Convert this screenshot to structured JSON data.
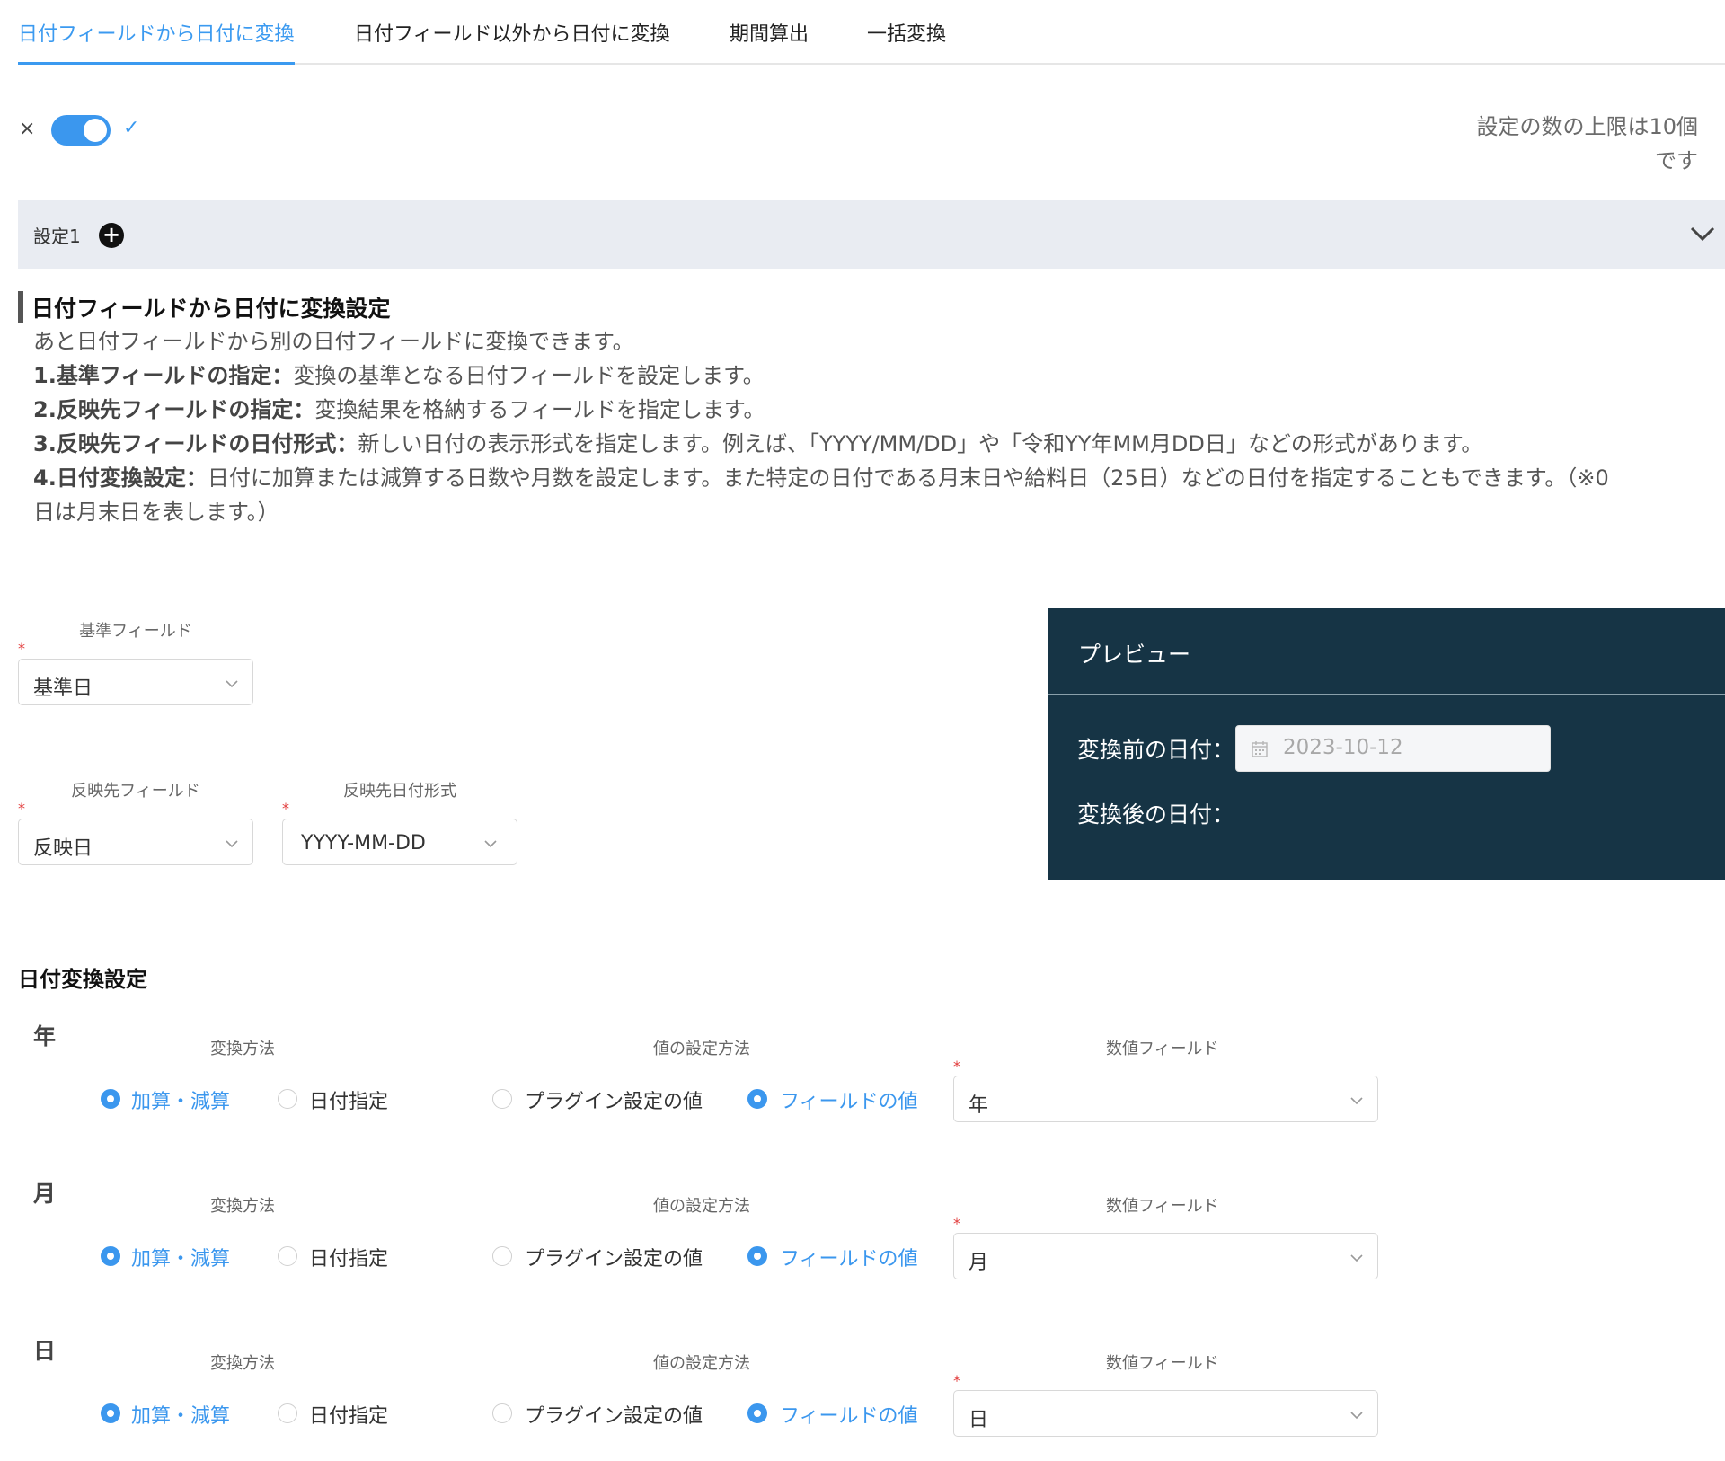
{
  "tabs": [
    {
      "label": "日付フィールドから日付に変換"
    },
    {
      "label": "日付フィールド以外から日付に変換"
    },
    {
      "label": "期間算出"
    },
    {
      "label": "一括変換"
    }
  ],
  "toggle": {
    "off_icon": "×",
    "on_icon": "✓",
    "enabled": true
  },
  "limit_note_line1": "設定の数の上限は10個",
  "limit_note_line2": "です",
  "setting": {
    "label": "設定1"
  },
  "description": {
    "title": "日付フィールドから日付に変換設定",
    "intro": "あと日付フィールドから別の日付フィールドに変換できます。",
    "items": [
      {
        "head": "1.基準フィールドの指定：",
        "text": "変換の基準となる日付フィールドを設定します。"
      },
      {
        "head": "2.反映先フィールドの指定：",
        "text": "変換結果を格納するフィールドを指定します。"
      },
      {
        "head": "3.反映先フィールドの日付形式：",
        "text": "新しい日付の表示形式を指定します。例えば、「YYYY/MM/DD」や「令和YY年MM月DD日」などの形式があります。"
      },
      {
        "head": "4.日付変換設定：",
        "text": "日付に加算または減算する日数や月数を設定します。また特定の日付である月末日や給料日（25日）などの日付を指定することもできます。（※0日は月末日を表します。）"
      }
    ]
  },
  "form": {
    "base_field": {
      "label": "基準フィールド",
      "value": "基準日"
    },
    "target_field": {
      "label": "反映先フィールド",
      "value": "反映日"
    },
    "target_format": {
      "label": "反映先日付形式",
      "value": "YYYY-MM-DD"
    },
    "required_mark": "*"
  },
  "preview": {
    "title": "プレビュー",
    "before_label": "変換前の日付：",
    "before_placeholder": "2023-10-12",
    "after_label": "変換後の日付："
  },
  "conversion": {
    "title": "日付変換設定",
    "col_method": "変換方法",
    "col_value_method": "値の設定方法",
    "col_numeric_field": "数値フィールド",
    "opt_add_sub": "加算・減算",
    "opt_date_spec": "日付指定",
    "opt_plugin_value": "プラグイン設定の値",
    "opt_field_value": "フィールドの値",
    "rows": [
      {
        "unit": "年",
        "field_value": "年"
      },
      {
        "unit": "月",
        "field_value": "月"
      },
      {
        "unit": "日",
        "field_value": "日"
      }
    ]
  },
  "colors": {
    "accent": "#3b97ee",
    "preview_bg": "#163445",
    "header_bg": "#e9ecf2",
    "required": "#e23b3b"
  }
}
